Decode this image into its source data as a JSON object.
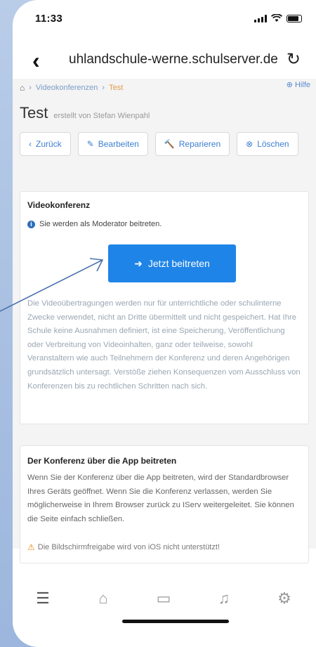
{
  "status_bar": {
    "time": "11:33"
  },
  "browser": {
    "url": "uhlandschule-werne.schulserver.de"
  },
  "breadcrumb": {
    "items": [
      "Videokonferenzen",
      "Test"
    ],
    "help": "Hilfe"
  },
  "page": {
    "title": "Test",
    "subtitle": "erstellt von Stefan Wienpahl"
  },
  "actions": [
    {
      "icon": "‹",
      "label": "Zurück"
    },
    {
      "icon": "✎",
      "label": "Bearbeiten"
    },
    {
      "icon": "🔨",
      "label": "Reparieren"
    },
    {
      "icon": "⊗",
      "label": "Löschen"
    }
  ],
  "conference": {
    "heading": "Videokonferenz",
    "info": "Sie werden als Moderator beitreten.",
    "join_label": "Jetzt beitreten",
    "disclaimer": "Die Videoübertragungen werden nur für unterrichtliche oder schulinterne Zwecke verwendet, nicht an Dritte übermittelt und nicht gespeichert. Hat Ihre Schule keine Ausnahmen definiert, ist eine Speicherung, Veröffentlichung oder Verbreitung von Videoinhalten, ganz oder teilweise, sowohl Veranstaltern wie auch Teilnehmern der Konferenz und deren Angehörigen grundsätzlich untersagt. Verstöße ziehen Konsequenzen vom Ausschluss von Konferenzen bis zu rechtlichen Schritten nach sich."
  },
  "app_join": {
    "heading": "Der Konferenz über die App beitreten",
    "text": "Wenn Sie der Konferenz über die App beitreten, wird der Standardbrowser Ihres Geräts geöffnet. Wenn Sie die Konferenz verlassen, werden Sie möglicherweise in Ihrem Browser zurück zu IServ weitergeleitet. Sie können die Seite einfach schließen.",
    "warning": "Die Bildschirmfreigabe wird von iOS nicht unterstützt!"
  },
  "tabbar": [
    "menu-icon",
    "home-icon",
    "chat-icon",
    "bell-icon",
    "settings-icon"
  ],
  "colors": {
    "primary": "#1f84e8",
    "link": "#3d7fd1",
    "warning": "#e4880a",
    "background": "#b9cde9"
  }
}
